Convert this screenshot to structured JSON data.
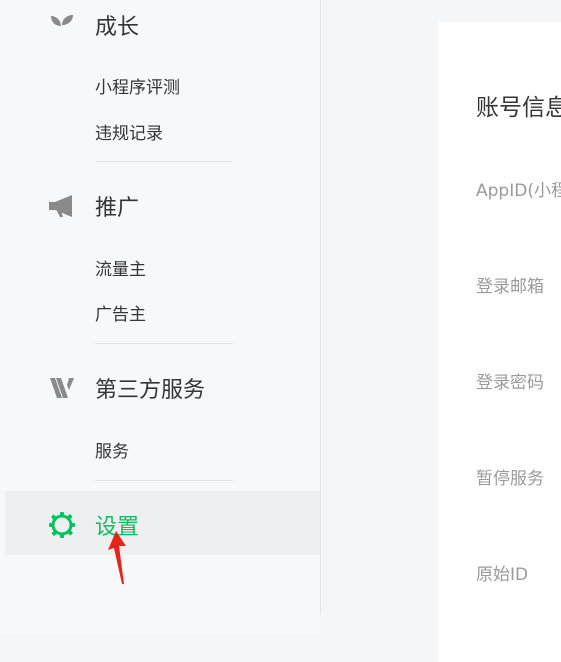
{
  "sidebar": {
    "growth": {
      "title": "成长",
      "items": [
        "小程序评测",
        "违规记录"
      ]
    },
    "promotion": {
      "title": "推广",
      "items": [
        "流量主",
        "广告主"
      ]
    },
    "third_party": {
      "title": "第三方服务",
      "items": [
        "服务"
      ]
    },
    "settings": {
      "title": "设置"
    }
  },
  "account": {
    "title": "账号信息",
    "fields": [
      "AppID(小程",
      "登录邮箱",
      "登录密码",
      "暂停服务",
      "原始ID"
    ]
  },
  "colors": {
    "accent": "#07c160",
    "annotation_arrow": "#e8231c"
  }
}
